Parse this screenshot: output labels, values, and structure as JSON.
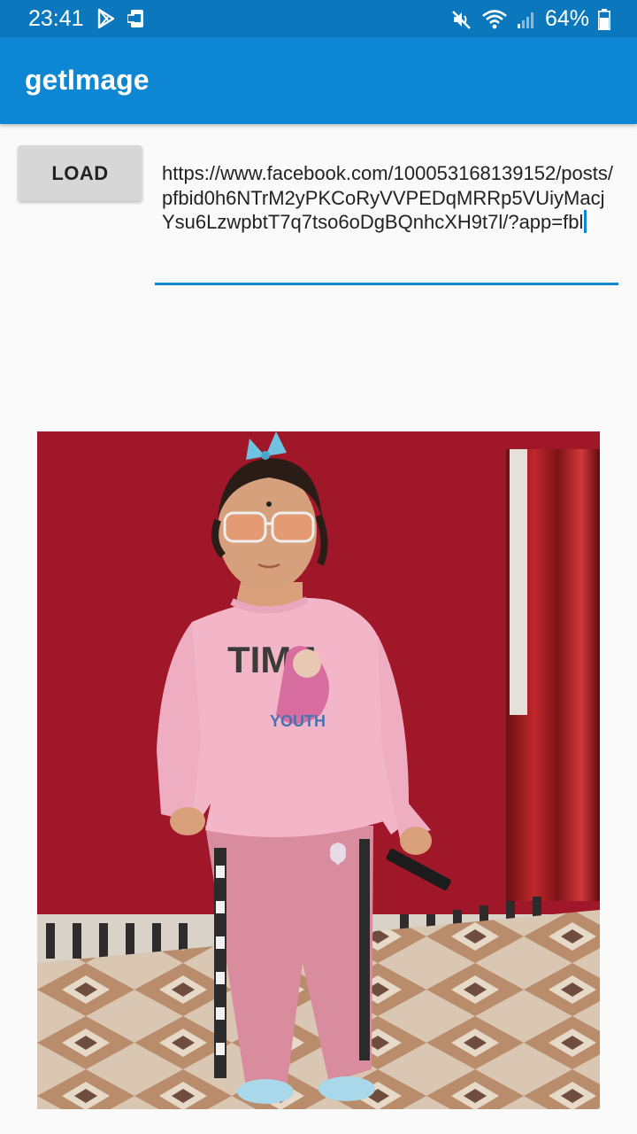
{
  "status_bar": {
    "time": "23:41",
    "battery": "64%",
    "icons": [
      "play-store-icon",
      "sim-icon",
      "mute-icon",
      "wifi-icon",
      "signal-icon",
      "battery-icon"
    ]
  },
  "app_bar": {
    "title": "getImage"
  },
  "load_button": {
    "label": "LOAD"
  },
  "url_input": {
    "value": "https://www.facebook.com/100053168139152/posts/pfbid0h6NTrM2yPKCoRyVVPEDqMRRp5VUiyMacjYsu6LzwpbtT7q7tso6oDgBQnhcXH9t7l/?app=fbl"
  },
  "photo": {
    "shirt_text_top": "TIME",
    "shirt_text_bottom": "YOUTH"
  },
  "colors": {
    "accent": "#0d87d3",
    "status_bar": "#0b78be"
  }
}
